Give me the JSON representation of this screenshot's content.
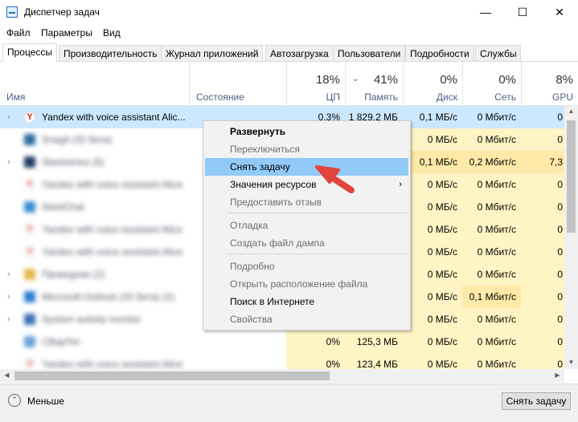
{
  "window": {
    "title": "Диспетчер задач",
    "controls": [
      "—",
      "☐",
      "✕"
    ]
  },
  "menu": [
    "Файл",
    "Параметры",
    "Вид"
  ],
  "tabs": [
    "Процессы",
    "Производительность",
    "Журнал приложений",
    "Автозагрузка",
    "Пользователи",
    "Подробности",
    "Службы"
  ],
  "columns": {
    "name": "Имя",
    "status": "Состояние",
    "cpu": {
      "pct": "18%",
      "label": "ЦП"
    },
    "memory": {
      "pct": "41%",
      "label": "Память",
      "sort": "⌄"
    },
    "disk": {
      "pct": "0%",
      "label": "Диск"
    },
    "network": {
      "pct": "0%",
      "label": "Сеть"
    },
    "gpu": {
      "pct": "8%",
      "label": "GPU"
    }
  },
  "rows": [
    {
      "name": "Yandex with voice assistant Alic...",
      "cpu": "0,3%",
      "mem": "1 829,2 МБ",
      "disk": "0,1 МБ/с",
      "net": "0 Мбит/с",
      "gpu": "0"
    },
    {
      "name": "Snagit (32 бита)",
      "cpu": "",
      "mem": "",
      "disk": "0 МБ/с",
      "net": "0 Мбит/с",
      "gpu": "0"
    },
    {
      "name": "Steelseries (5)",
      "cpu": "",
      "mem": "",
      "disk": "0,1 МБ/с",
      "net": "0,2 Мбит/с",
      "gpu": "7,3"
    },
    {
      "name": "Yandex with voice assistant Alice",
      "cpu": "",
      "mem": "",
      "disk": "0 МБ/с",
      "net": "0 Мбит/с",
      "gpu": "0"
    },
    {
      "name": "SteelChat",
      "cpu": "",
      "mem": "",
      "disk": "0 МБ/с",
      "net": "0 Мбит/с",
      "gpu": "0"
    },
    {
      "name": "Yandex with voice assistant Alice",
      "cpu": "",
      "mem": "",
      "disk": "0 МБ/с",
      "net": "0 Мбит/с",
      "gpu": "0"
    },
    {
      "name": "Yandex with voice assistant Alice",
      "cpu": "",
      "mem": "",
      "disk": "0 МБ/с",
      "net": "0 Мбит/с",
      "gpu": "0"
    },
    {
      "name": "Проводник (2)",
      "cpu": "",
      "mem": "",
      "disk": "0 МБ/с",
      "net": "0 Мбит/с",
      "gpu": "0"
    },
    {
      "name": "Microsoft Outlook (32 бита) (2)",
      "cpu": "",
      "mem": "",
      "disk": "0 МБ/с",
      "net": "0,1 Мбит/с",
      "gpu": "0"
    },
    {
      "name": "System activity monitor",
      "cpu": "",
      "mem": "",
      "disk": "0 МБ/с",
      "net": "0 Мбит/с",
      "gpu": "0"
    },
    {
      "name": "CBapYer",
      "cpu": "0%",
      "mem": "125,3 МБ",
      "disk": "0 МБ/с",
      "net": "0 Мбит/с",
      "gpu": "0"
    },
    {
      "name": "Yandex with voice assistant Alice",
      "cpu": "0%",
      "mem": "123,4 МБ",
      "disk": "0 МБ/с",
      "net": "0 Мбит/с",
      "gpu": "0"
    }
  ],
  "context_menu": {
    "items": [
      {
        "label": "Развернуть",
        "bold": true
      },
      {
        "label": "Переключиться",
        "disabled": true
      },
      {
        "label": "Снять задачу",
        "highlighted": true
      },
      {
        "label": "Значения ресурсов",
        "submenu": "›"
      },
      {
        "label": "Предоставить отзыв",
        "disabled": true
      },
      {
        "label": "Отладка",
        "disabled": true
      },
      {
        "label": "Создать файл дампа",
        "disabled": true
      },
      {
        "label": "Подробно",
        "disabled": true
      },
      {
        "label": "Открыть расположение файла",
        "disabled": true
      },
      {
        "label": "Поиск в Интернете"
      },
      {
        "label": "Свойства",
        "disabled": true
      }
    ]
  },
  "footer": {
    "less_label": "Меньше",
    "end_task_label": "Снять задачу"
  },
  "colors": {
    "heat_light": "#fff4c4",
    "heat_row_selected": "#cce8ff",
    "menu_highlight": "#91c9f7",
    "arrow_red": "#e0443c",
    "header_label": "#4d6082"
  }
}
